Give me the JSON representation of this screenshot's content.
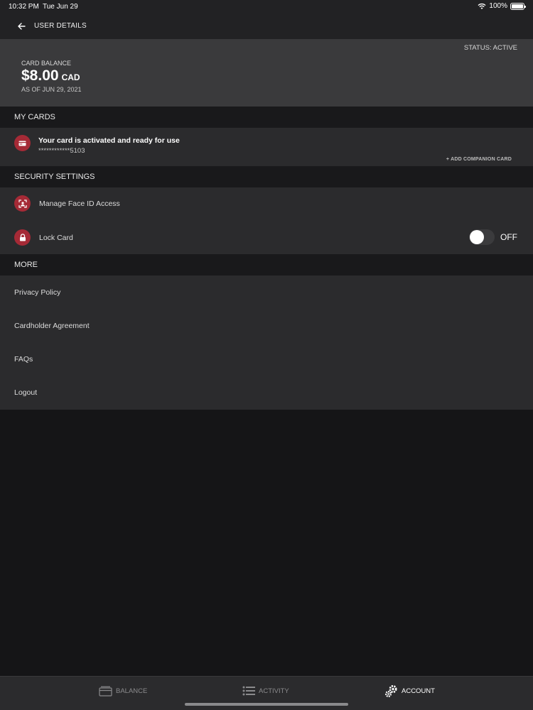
{
  "status_bar": {
    "time": "10:32 PM",
    "date": "Tue Jun 29",
    "battery": "100%"
  },
  "nav": {
    "title": "USER DETAILS"
  },
  "balance": {
    "status": "STATUS: ACTIVE",
    "label": "CARD BALANCE",
    "amount": "$8.00",
    "currency": "CAD",
    "as_of": "AS OF JUN 29, 2021"
  },
  "my_cards": {
    "header": "MY CARDS",
    "card_title": "Your card is activated and ready for use",
    "card_number": "************5103",
    "companion_link": "+ ADD COMPANION CARD"
  },
  "security": {
    "header": "SECURITY SETTINGS",
    "face_id_label": "Manage Face ID Access",
    "lock_card_label": "Lock Card",
    "lock_card_state": "OFF"
  },
  "more": {
    "header": "MORE",
    "items": [
      "Privacy Policy",
      "Cardholder Agreement",
      "FAQs",
      "Logout"
    ]
  },
  "tabs": [
    {
      "label": "BALANCE",
      "icon": "card-icon",
      "active": false
    },
    {
      "label": "ACTIVITY",
      "icon": "list-icon",
      "active": false
    },
    {
      "label": "ACCOUNT",
      "icon": "gears-icon",
      "active": true
    }
  ],
  "colors": {
    "accent": "#a52a36",
    "background": "#151517",
    "panel": "#2b2b2d"
  }
}
